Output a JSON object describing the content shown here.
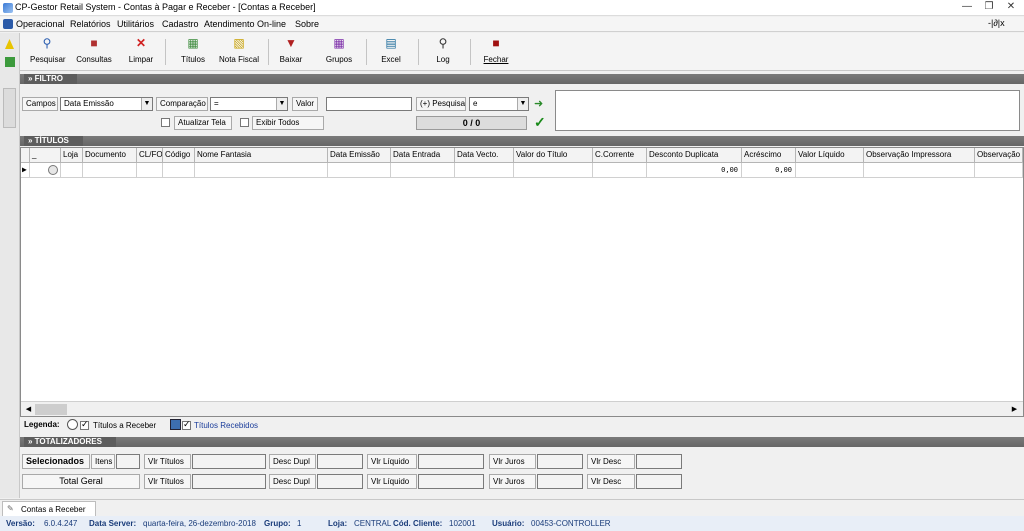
{
  "window": {
    "title": "CP-Gestor Retail System - Contas à Pagar e Receber - [Contas a Receber]",
    "controls": [
      "—",
      "❐",
      "✕"
    ]
  },
  "menu": {
    "items": [
      "Operacional",
      "Relatórios",
      "Utilitários",
      "Cadastro",
      "Atendimento On-line",
      "Sobre"
    ],
    "mdi_controls": "-|∂|x"
  },
  "toolbar": {
    "buttons": [
      {
        "label": "Pesquisar",
        "icon": "search-icon"
      },
      {
        "label": "Consultas",
        "icon": "consult-icon"
      },
      {
        "label": "Limpar",
        "icon": "clear-icon"
      },
      {
        "label": "Títulos",
        "icon": "titles-icon"
      },
      {
        "label": "Nota Fiscal",
        "icon": "invoice-icon"
      },
      {
        "label": "Baixar",
        "icon": "download-icon"
      },
      {
        "label": "Grupos",
        "icon": "groups-icon"
      },
      {
        "label": "Excel",
        "icon": "excel-icon"
      },
      {
        "label": "Log",
        "icon": "log-icon"
      },
      {
        "label": "Fechar",
        "icon": "close-icon"
      }
    ]
  },
  "filtro": {
    "header": "» FILTRO",
    "campos_label": "Campos",
    "campos_value": "Data Emissão",
    "comparacao_label": "Comparação",
    "comparacao_value": "=",
    "valor_label": "Valor",
    "valor_value": "",
    "pesquisa_label": "(+) Pesquisa",
    "pesquisa_value": "e",
    "atualizar_label": "Atualizar Tela",
    "exibir_label": "Exibir Todos",
    "counter": "0 / 0"
  },
  "titulos": {
    "header": "» TÍTULOS",
    "columns": [
      "_",
      "Loja",
      "Documento",
      "CL/FO",
      "Código",
      "Nome Fantasia",
      "Data Emissão",
      "Data Entrada",
      "Data Vecto.",
      "Valor do Título",
      "C.Corrente",
      "Desconto Duplicata",
      "Acréscimo",
      "Valor Líquido",
      "Observação Impressora",
      "Observação"
    ],
    "row": {
      "desconto": "0,00",
      "acrescimo": "0,00"
    }
  },
  "legenda": {
    "label": "Legenda:",
    "receber": "Títulos a Receber",
    "recebidos": "Títulos Recebidos"
  },
  "totalizadores": {
    "header": "» TOTALIZADORES",
    "selecionados": "Selecionados",
    "itens": "Itens",
    "total_geral": "Total Geral",
    "vlr_titulos": "Vlr Títulos",
    "desc_dupl": "Desc Dupl",
    "vlr_liquido": "Vlr Líquido",
    "vlr_juros": "Vlr Juros",
    "vlr_desc": "Vlr Desc"
  },
  "tab": {
    "label": "Contas a Receber"
  },
  "status": {
    "versao_label": "Versão:",
    "versao": "6.0.4.247",
    "dataserver_label": "Data Server:",
    "dataserver": "quarta-feira, 26-dezembro-2018",
    "grupo_label": "Grupo:",
    "grupo": "1",
    "loja_label": "Loja:",
    "loja": "CENTRAL",
    "cliente_label": "Cód. Cliente:",
    "cliente": "102001",
    "usuario_label": "Usuário:",
    "usuario": "00453-CONTROLLER"
  },
  "colors": {
    "section": "#6f6f6f",
    "accent": "#1a3c7a"
  }
}
